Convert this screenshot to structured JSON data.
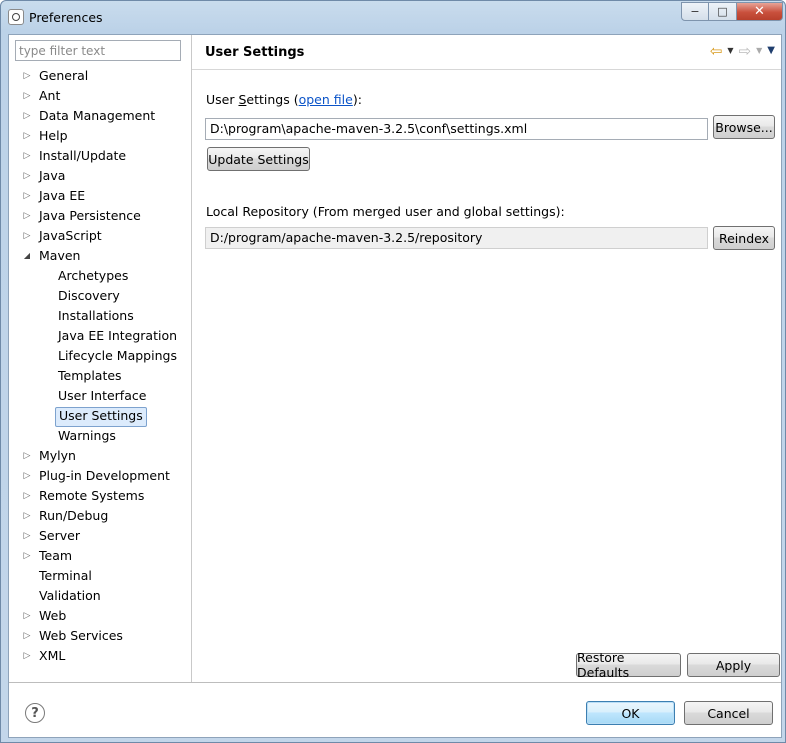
{
  "window": {
    "title": "Preferences",
    "caption": {
      "minimize": "−",
      "maximize": "□",
      "close": "✕"
    }
  },
  "filter": {
    "placeholder": "type filter text",
    "value": ""
  },
  "tree": [
    {
      "label": "General",
      "level": 0,
      "expander": "collapsed"
    },
    {
      "label": "Ant",
      "level": 0,
      "expander": "collapsed"
    },
    {
      "label": "Data Management",
      "level": 0,
      "expander": "collapsed"
    },
    {
      "label": "Help",
      "level": 0,
      "expander": "collapsed"
    },
    {
      "label": "Install/Update",
      "level": 0,
      "expander": "collapsed"
    },
    {
      "label": "Java",
      "level": 0,
      "expander": "collapsed"
    },
    {
      "label": "Java EE",
      "level": 0,
      "expander": "collapsed"
    },
    {
      "label": "Java Persistence",
      "level": 0,
      "expander": "collapsed"
    },
    {
      "label": "JavaScript",
      "level": 0,
      "expander": "collapsed"
    },
    {
      "label": "Maven",
      "level": 0,
      "expander": "expanded"
    },
    {
      "label": "Archetypes",
      "level": 1,
      "expander": "none"
    },
    {
      "label": "Discovery",
      "level": 1,
      "expander": "none"
    },
    {
      "label": "Installations",
      "level": 1,
      "expander": "none"
    },
    {
      "label": "Java EE Integration",
      "level": 1,
      "expander": "none"
    },
    {
      "label": "Lifecycle Mappings",
      "level": 1,
      "expander": "none"
    },
    {
      "label": "Templates",
      "level": 1,
      "expander": "none"
    },
    {
      "label": "User Interface",
      "level": 1,
      "expander": "none"
    },
    {
      "label": "User Settings",
      "level": 1,
      "expander": "none",
      "selected": true
    },
    {
      "label": "Warnings",
      "level": 1,
      "expander": "none"
    },
    {
      "label": "Mylyn",
      "level": 0,
      "expander": "collapsed"
    },
    {
      "label": "Plug-in Development",
      "level": 0,
      "expander": "collapsed"
    },
    {
      "label": "Remote Systems",
      "level": 0,
      "expander": "collapsed"
    },
    {
      "label": "Run/Debug",
      "level": 0,
      "expander": "collapsed"
    },
    {
      "label": "Server",
      "level": 0,
      "expander": "collapsed"
    },
    {
      "label": "Team",
      "level": 0,
      "expander": "collapsed"
    },
    {
      "label": "Terminal",
      "level": 0,
      "expander": "none"
    },
    {
      "label": "Validation",
      "level": 0,
      "expander": "none"
    },
    {
      "label": "Web",
      "level": 0,
      "expander": "collapsed"
    },
    {
      "label": "Web Services",
      "level": 0,
      "expander": "collapsed"
    },
    {
      "label": "XML",
      "level": 0,
      "expander": "collapsed"
    }
  ],
  "page": {
    "title": "User Settings",
    "nav": {
      "back_icon": "back-arrow-icon",
      "forward_icon": "forward-arrow-icon",
      "menu_icon": "view-menu-icon"
    },
    "user_settings": {
      "label_pre": "User ",
      "label_mnemonic": "S",
      "label_post": "ettings (",
      "link": "open file",
      "label_end": "):",
      "value": "D:\\program\\apache-maven-3.2.5\\conf\\settings.xml",
      "browse_label": "Browse...",
      "update_label": "Update Settings"
    },
    "local_repo": {
      "label": "Local Repository (From merged user and global settings):",
      "value": "D:/program/apache-maven-3.2.5/repository",
      "reindex_label": "Reindex"
    },
    "restore_defaults_label": "Restore Defaults",
    "apply_label": "Apply"
  },
  "footer": {
    "help_glyph": "?",
    "ok_label": "OK",
    "cancel_label": "Cancel"
  },
  "colors": {
    "accent_link": "#0b54c8",
    "selection_bg": "#dcebfc",
    "window_frame": "#bcd2e8"
  }
}
